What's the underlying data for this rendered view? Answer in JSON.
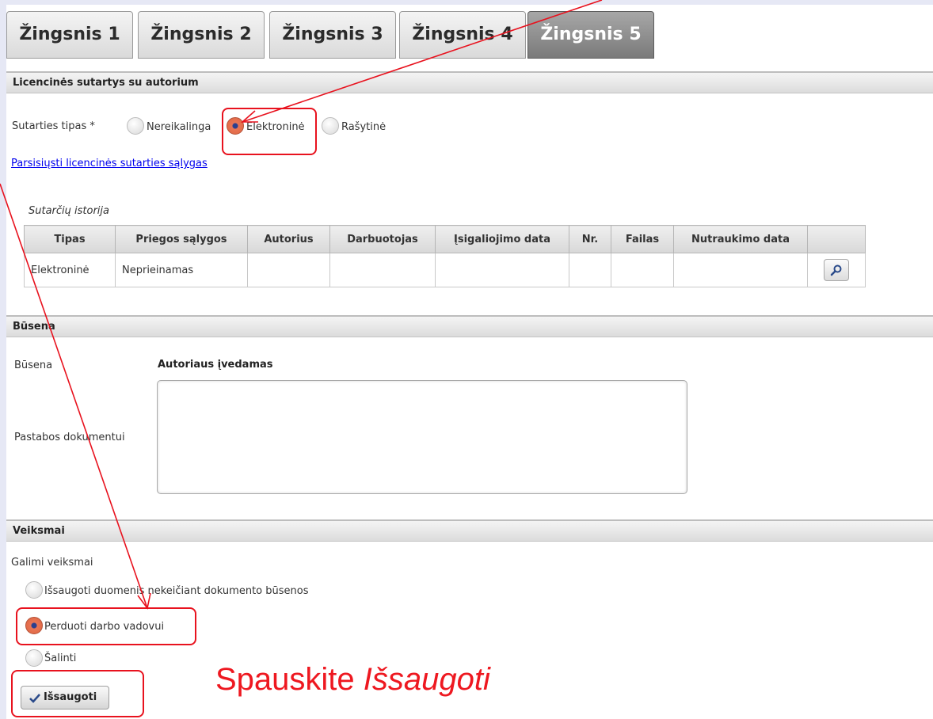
{
  "tabs": [
    "Žingsnis 1",
    "Žingsnis 2",
    "Žingsnis 3",
    "Žingsnis 4",
    "Žingsnis 5"
  ],
  "license": {
    "header": "Licencinės sutartys su autorium",
    "type_label": "Sutarties tipas *",
    "options": [
      "Nereikalinga",
      "Elektroninė",
      "Rašytinė"
    ],
    "selected": "Elektroninė",
    "link": "Parsisiųsti licencinės sutarties sąlygas"
  },
  "history": {
    "caption": "Sutarčių istorija",
    "columns": [
      "Tipas",
      "Priegos sąlygos",
      "Autorius",
      "Darbuotojas",
      "Įsigaliojimo data",
      "Nr.",
      "Failas",
      "Nutraukimo data",
      ""
    ],
    "rows": [
      [
        "Elektroninė",
        "Neprieinamas",
        "",
        "",
        "",
        "",
        "",
        "",
        ""
      ]
    ]
  },
  "status": {
    "header": "Būsena",
    "label": "Būsena",
    "value": "Autoriaus įvedamas",
    "notes_label": "Pastabos dokumentui",
    "notes_value": ""
  },
  "actions": {
    "header": "Veiksmai",
    "label": "Galimi veiksmai",
    "options": [
      "Išsaugoti duomenis nekeičiant dokumento būsenos",
      "Perduoti darbo vadovui",
      "Šalinti"
    ],
    "selected": "Perduoti darbo vadovui",
    "save_label": "Išsaugoti"
  },
  "instruction": {
    "prefix": "Spauskite ",
    "emphasis": "Išsaugoti"
  },
  "colors": {
    "annotation": "#e8121e",
    "radio_checked": "#e0643f",
    "link": "#0000ee",
    "active_tab": "#8a8a8a"
  },
  "icons": [
    "magnifier-icon",
    "checkmark-icon"
  ]
}
